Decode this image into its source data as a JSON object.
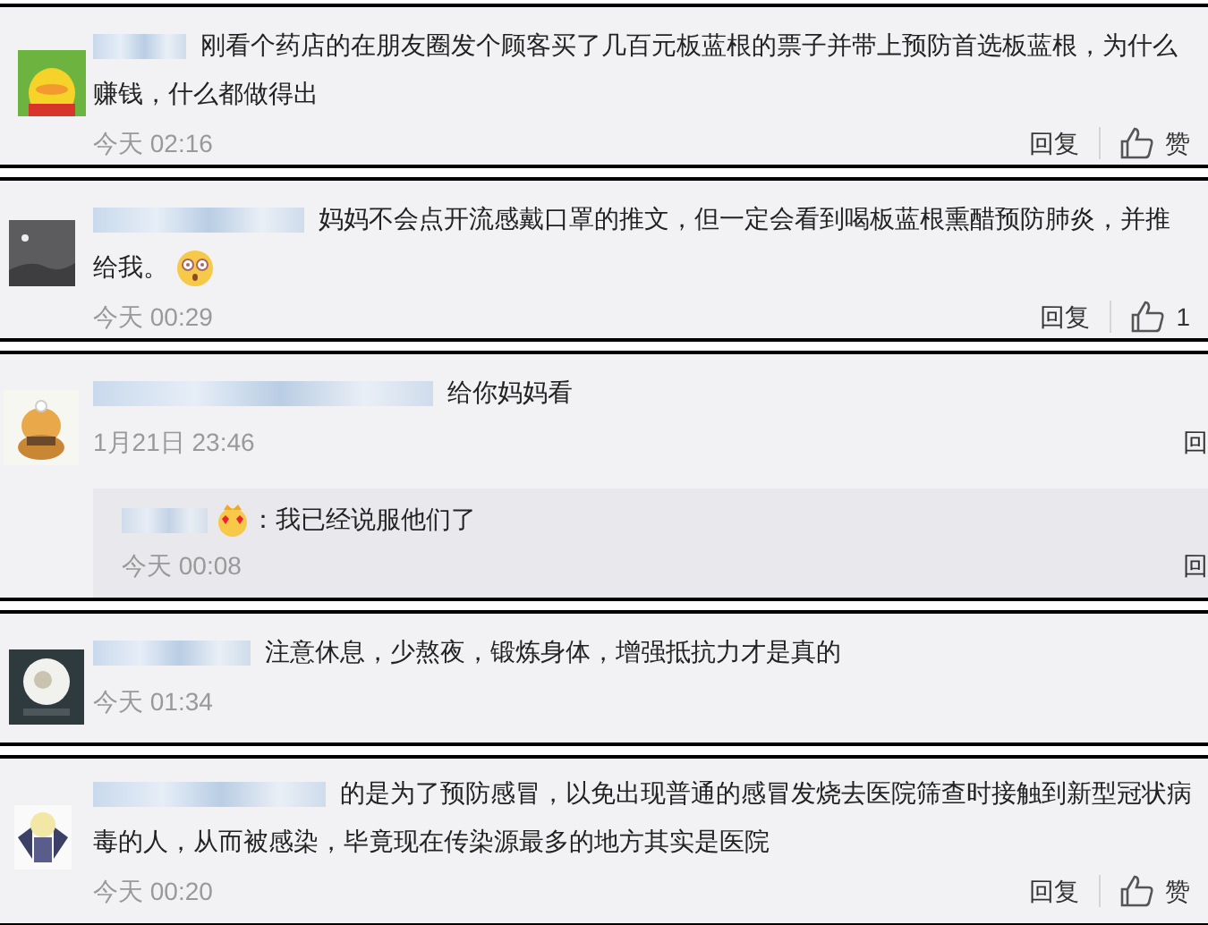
{
  "comments": [
    {
      "text": "刚看个药店的在朋友圈发个顾客买了几百元板蓝根的票子并带上预防首选板蓝根，为什么赚钱，什么都做得出",
      "trailing_emoji": false,
      "time": "今天 02:16",
      "reply_label": "回复",
      "like_label": "赞"
    },
    {
      "text": "妈妈不会点开流感戴口罩的推文，但一定会看到喝板蓝根熏醋预防肺炎，并推给我。",
      "trailing_emoji": true,
      "time": "今天 00:29",
      "reply_label": "回复",
      "like_label": "1"
    },
    {
      "text": "给你妈妈看",
      "trailing_emoji": false,
      "time": "1月21日 23:46",
      "reply_label": "回",
      "replies": [
        {
          "text": "：我已经说服他们了",
          "time": "今天 00:08",
          "reply_label": "回"
        }
      ]
    },
    {
      "text": "注意休息，少熬夜，锻炼身体，增强抵抗力才是真的",
      "trailing_emoji": false,
      "time": "今天 01:34"
    },
    {
      "text": "的是为了预防感冒，以免出现普通的感冒发烧去医院筛查时接触到新型冠状病毒的人，从而被感染，毕竟现在传染源最多的地方其实是医院",
      "trailing_emoji": false,
      "time": "今天 00:20",
      "reply_label": "回复",
      "like_label": "赞"
    }
  ]
}
